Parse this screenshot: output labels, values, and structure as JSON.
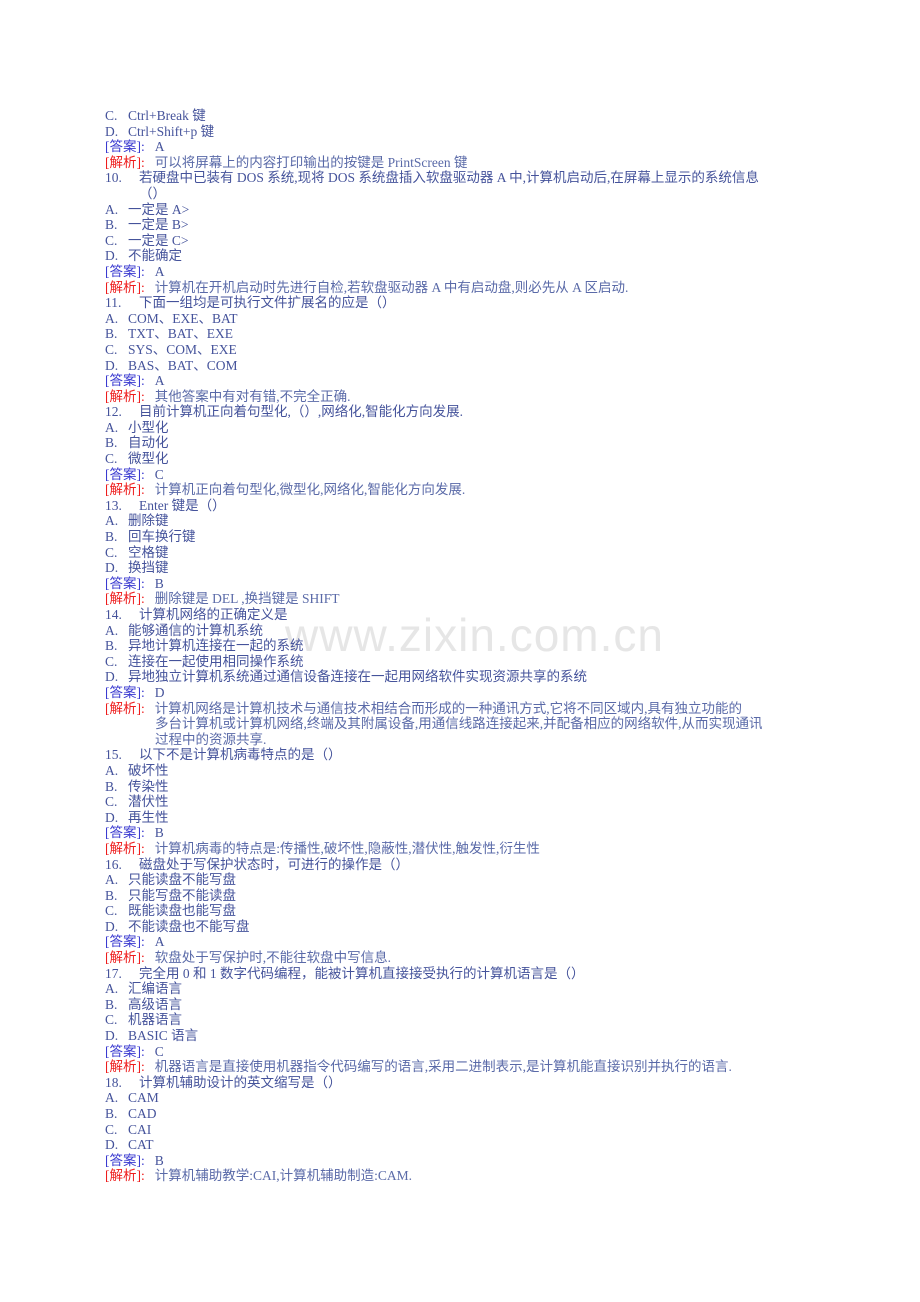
{
  "watermark": {
    "text": "www.zixin.com.cn"
  },
  "labels": {
    "answer": "[答案]:",
    "analysis": "[解析]:"
  },
  "blocks": [
    {
      "kind": "option",
      "letter": "C.",
      "text": "Ctrl+Break 键"
    },
    {
      "kind": "option",
      "letter": "D.",
      "text": "Ctrl+Shift+p 键"
    },
    {
      "kind": "answer",
      "value": "A"
    },
    {
      "kind": "analysis",
      "lines": [
        "可以将屏幕上的内容打印输出的按键是 PrintScreen 键"
      ]
    },
    {
      "kind": "stem",
      "num": "10.",
      "lines": [
        "若硬盘中已装有 DOS 系统,现将 DOS 系统盘插入软盘驱动器 A 中,计算机启动后,在屏幕上显示的系统信息",
        "（）"
      ]
    },
    {
      "kind": "option",
      "letter": "A.",
      "text": "一定是 A>"
    },
    {
      "kind": "option",
      "letter": "B.",
      "text": "一定是 B>"
    },
    {
      "kind": "option",
      "letter": "C.",
      "text": "一定是 C>"
    },
    {
      "kind": "option",
      "letter": "D.",
      "text": "不能确定"
    },
    {
      "kind": "answer",
      "value": "A"
    },
    {
      "kind": "analysis",
      "lines": [
        "计算机在开机启动时先进行自检,若软盘驱动器 A 中有启动盘,则必先从 A 区启动."
      ]
    },
    {
      "kind": "stem",
      "num": "11.",
      "lines": [
        "下面一组均是可执行文件扩展名的应是（）"
      ]
    },
    {
      "kind": "option",
      "letter": "A.",
      "text": "COM、EXE、BAT"
    },
    {
      "kind": "option",
      "letter": "B.",
      "text": "TXT、BAT、EXE"
    },
    {
      "kind": "option",
      "letter": "C.",
      "text": "SYS、COM、EXE"
    },
    {
      "kind": "option",
      "letter": "D.",
      "text": "BAS、BAT、COM"
    },
    {
      "kind": "answer",
      "value": "A"
    },
    {
      "kind": "analysis",
      "lines": [
        "其他答案中有对有错,不完全正确."
      ]
    },
    {
      "kind": "stem",
      "num": "12.",
      "lines": [
        "目前计算机正向着句型化,（）,网络化,智能化方向发展."
      ]
    },
    {
      "kind": "option",
      "letter": "A.",
      "text": "小型化"
    },
    {
      "kind": "option",
      "letter": "B.",
      "text": "自动化"
    },
    {
      "kind": "option",
      "letter": "C.",
      "text": "微型化"
    },
    {
      "kind": "answer",
      "value": "C"
    },
    {
      "kind": "analysis",
      "lines": [
        "计算机正向着句型化,微型化,网络化,智能化方向发展."
      ]
    },
    {
      "kind": "stem",
      "num": "13.",
      "lines": [
        "Enter 键是（）"
      ]
    },
    {
      "kind": "option",
      "letter": "A.",
      "text": "删除键"
    },
    {
      "kind": "option",
      "letter": "B.",
      "text": "回车换行键"
    },
    {
      "kind": "option",
      "letter": "C.",
      "text": "空格键"
    },
    {
      "kind": "option",
      "letter": "D.",
      "text": "换挡键"
    },
    {
      "kind": "answer",
      "value": "B"
    },
    {
      "kind": "analysis",
      "lines": [
        "删除键是 DEL ,换挡键是 SHIFT"
      ]
    },
    {
      "kind": "stem",
      "num": "14.",
      "lines": [
        "计算机网络的正确定义是"
      ]
    },
    {
      "kind": "option",
      "letter": "A.",
      "text": "能够通信的计算机系统"
    },
    {
      "kind": "option",
      "letter": "B.",
      "text": "异地计算机连接在一起的系统"
    },
    {
      "kind": "option",
      "letter": "C.",
      "text": "连接在一起使用相同操作系统"
    },
    {
      "kind": "option",
      "letter": "D.",
      "text": "异地独立计算机系统通过通信设备连接在一起用网络软件实现资源共享的系统"
    },
    {
      "kind": "answer",
      "value": "D"
    },
    {
      "kind": "analysis",
      "lines": [
        "计算机网络是计算机技术与通信技术相结合而形成的一种通讯方式,它将不同区域内,具有独立功能的",
        "多台计算机或计算机网络,终端及其附属设备,用通信线路连接起来,并配备相应的网络软件,从而实现通讯",
        "过程中的资源共享."
      ]
    },
    {
      "kind": "stem",
      "num": "15.",
      "lines": [
        "以下不是计算机病毒特点的是（）"
      ]
    },
    {
      "kind": "option",
      "letter": "A.",
      "text": "破坏性"
    },
    {
      "kind": "option",
      "letter": "B.",
      "text": "传染性"
    },
    {
      "kind": "option",
      "letter": "C.",
      "text": "潜伏性"
    },
    {
      "kind": "option",
      "letter": "D.",
      "text": "再生性"
    },
    {
      "kind": "answer",
      "value": "B"
    },
    {
      "kind": "analysis",
      "lines": [
        "计算机病毒的特点是:传播性,破坏性,隐蔽性,潜伏性,触发性,衍生性"
      ]
    },
    {
      "kind": "stem",
      "num": "16.",
      "lines": [
        "磁盘处于写保护状态时，可进行的操作是（）"
      ]
    },
    {
      "kind": "option",
      "letter": "A.",
      "text": "只能读盘不能写盘"
    },
    {
      "kind": "option",
      "letter": "B.",
      "text": "只能写盘不能读盘"
    },
    {
      "kind": "option",
      "letter": "C.",
      "text": "既能读盘也能写盘"
    },
    {
      "kind": "option",
      "letter": "D.",
      "text": "不能读盘也不能写盘"
    },
    {
      "kind": "answer",
      "value": "A"
    },
    {
      "kind": "analysis",
      "lines": [
        "软盘处于写保护时,不能往软盘中写信息."
      ]
    },
    {
      "kind": "stem",
      "num": "17.",
      "lines": [
        "完全用 0 和 1 数字代码编程，能被计算机直接接受执行的计算机语言是（）"
      ]
    },
    {
      "kind": "option",
      "letter": "A.",
      "text": "汇编语言"
    },
    {
      "kind": "option",
      "letter": "B.",
      "text": "高级语言"
    },
    {
      "kind": "option",
      "letter": "C.",
      "text": "机器语言"
    },
    {
      "kind": "option",
      "letter": "D.",
      "text": "BASIC 语言"
    },
    {
      "kind": "answer",
      "value": "C"
    },
    {
      "kind": "analysis",
      "lines": [
        "机器语言是直接使用机器指令代码编写的语言,采用二进制表示,是计算机能直接识别并执行的语言."
      ]
    },
    {
      "kind": "stem",
      "num": "18.",
      "lines": [
        "计算机辅助设计的英文缩写是（）"
      ]
    },
    {
      "kind": "option",
      "letter": "A.",
      "text": "CAM"
    },
    {
      "kind": "option",
      "letter": "B.",
      "text": "CAD"
    },
    {
      "kind": "option",
      "letter": "C.",
      "text": "CAI"
    },
    {
      "kind": "option",
      "letter": "D.",
      "text": "CAT"
    },
    {
      "kind": "answer",
      "value": "B"
    },
    {
      "kind": "analysis",
      "lines": [
        "计算机辅助教学:CAI,计算机辅助制造:CAM."
      ]
    }
  ]
}
